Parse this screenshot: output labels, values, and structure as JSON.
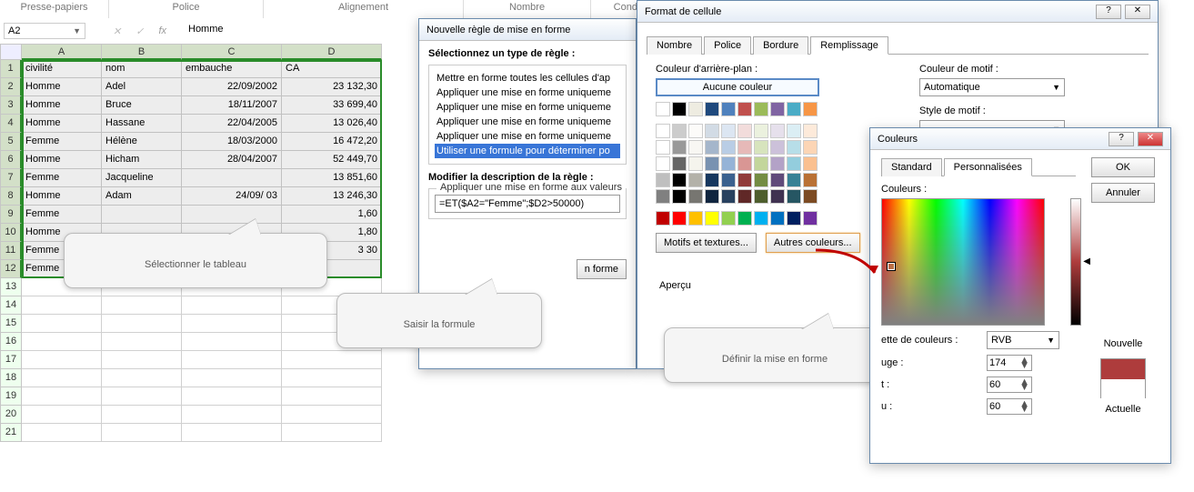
{
  "ribbon": {
    "clipboard": "Presse-papiers",
    "font": "Police",
    "alignment": "Alignement",
    "number": "Nombre",
    "conditional": "Conditionnelle"
  },
  "namebox": {
    "value": "A2"
  },
  "formulabar": {
    "fx": "fx",
    "value": "Homme"
  },
  "columns": [
    "A",
    "B",
    "C",
    "D"
  ],
  "headers": {
    "civilite": "civilité",
    "nom": "nom",
    "embauche": "embauche",
    "ca": "CA"
  },
  "rows": [
    {
      "a": "Homme",
      "b": "Adel",
      "c": "22/09/2002",
      "d": "23 132,30"
    },
    {
      "a": "Homme",
      "b": "Bruce",
      "c": "18/11/2007",
      "d": "33 699,40"
    },
    {
      "a": "Homme",
      "b": "Hassane",
      "c": "22/04/2005",
      "d": "13 026,40"
    },
    {
      "a": "Femme",
      "b": "Hélène",
      "c": "18/03/2000",
      "d": "16 472,20"
    },
    {
      "a": "Homme",
      "b": "Hicham",
      "c": "28/04/2007",
      "d": "52 449,70"
    },
    {
      "a": "Femme",
      "b": "Jacqueline",
      "c": "",
      "d": "13 851,60"
    },
    {
      "a": "Homme",
      "b": "Adam",
      "c": "24/09/   03",
      "d": "13 246,30"
    },
    {
      "a": "Femme",
      "b": "",
      "c": "",
      "d": "1,60"
    },
    {
      "a": "Homme",
      "b": "",
      "c": "",
      "d": "1,80"
    },
    {
      "a": "Femme",
      "b": "",
      "c": "",
      "d": "3  30"
    },
    {
      "a": "Femme",
      "b": "",
      "c": "",
      "d": ""
    }
  ],
  "ruleDialog": {
    "title": "Nouvelle règle de mise en forme",
    "selectLabel": "Sélectionnez un type de règle :",
    "rules": [
      "Mettre en forme toutes les cellules d'ap",
      "Appliquer une mise en forme uniqueme",
      "Appliquer une mise en forme uniqueme",
      "Appliquer une mise en forme uniqueme",
      "Appliquer une mise en forme uniqueme",
      "Utiliser une formule pour déterminer po"
    ],
    "descLabel": "Modifier la description de la règle :",
    "applyLabel": "Appliquer une mise en forme aux valeurs",
    "formula": "=ET($A2=\"Femme\";$D2>50000)",
    "formatBtn": "n forme"
  },
  "formatCell": {
    "title": "Format de cellule",
    "tabs": {
      "number": "Nombre",
      "font": "Police",
      "border": "Bordure",
      "fill": "Remplissage"
    },
    "bgLabel": "Couleur d'arrière-plan :",
    "noColor": "Aucune couleur",
    "patternsBtn": "Motifs et textures...",
    "otherColorsBtn": "Autres couleurs...",
    "patternColorLabel": "Couleur de motif :",
    "automatic": "Automatique",
    "patternStyleLabel": "Style de motif :",
    "previewLabel": "Aperçu"
  },
  "colorsDialog": {
    "title": "Couleurs",
    "tabs": {
      "standard": "Standard",
      "custom": "Personnalisées"
    },
    "colorsLabel": "Couleurs :",
    "modelLabel": "ette de couleurs :",
    "model": "RVB",
    "redLabel": "uge :",
    "red": "174",
    "greenLabel": "t :",
    "green": "60",
    "blueLabel": "u :",
    "blue": "60",
    "ok": "OK",
    "cancel": "Annuler",
    "new": "Nouvelle",
    "current": "Actuelle",
    "newColor": "#ae3c3c",
    "currentColor": "#ffffff"
  },
  "callouts": {
    "c1": "Sélectionner le tableau",
    "c2": "Saisir la formule",
    "c3": "Définir la mise en forme"
  }
}
